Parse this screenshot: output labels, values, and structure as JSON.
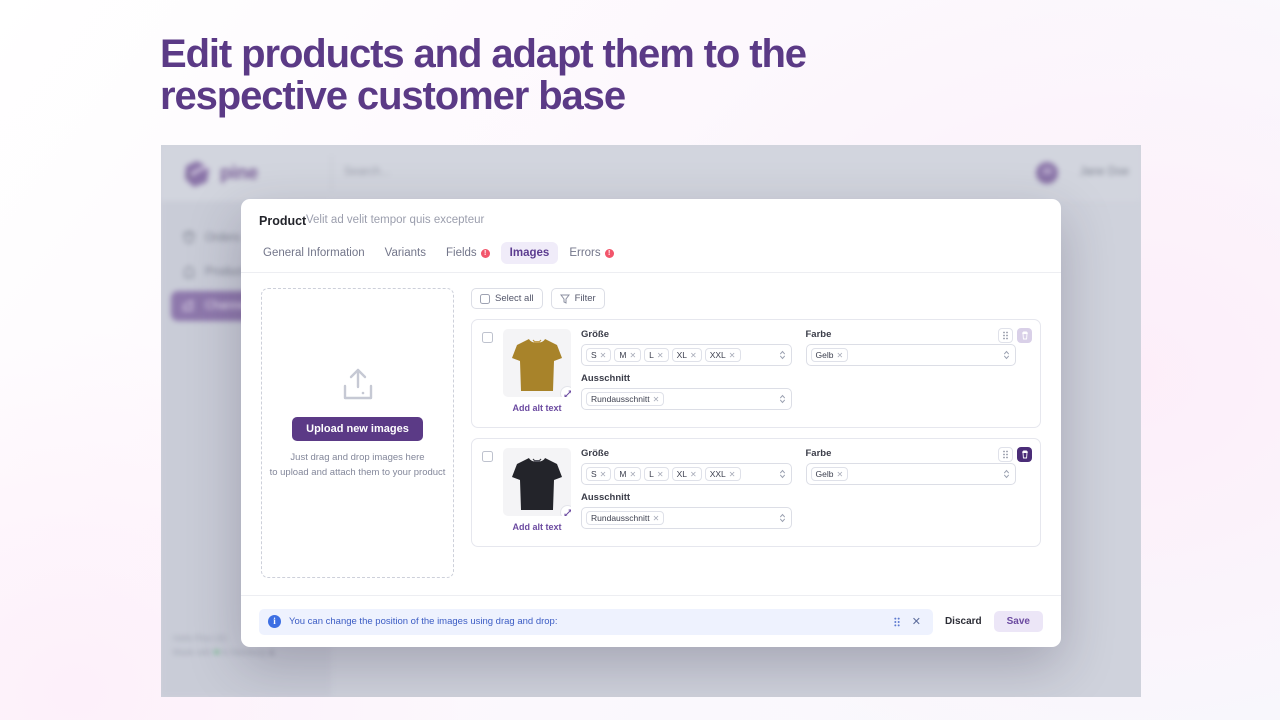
{
  "headline": {
    "line1": "Edit products and adapt them to the",
    "line2": "respective customer base"
  },
  "app": {
    "brand": "pine",
    "search_placeholder": "Search...",
    "user": {
      "name": "Jane Doe",
      "initials": "JD"
    },
    "nav": [
      {
        "label": "Orders",
        "icon": "bag-icon",
        "active": false
      },
      {
        "label": "Products",
        "icon": "tag-icon",
        "active": false
      },
      {
        "label": "Channels",
        "icon": "channel-icon",
        "active": true
      }
    ],
    "footer": {
      "company": "Hello Pine UG",
      "made_with_prefix": "Made with",
      "made_with_suffix": "in Hamburg"
    }
  },
  "modal": {
    "title": "Product",
    "subtitle": "Velit ad velit tempor quis excepteur",
    "tabs": [
      {
        "label": "General Information",
        "badge": false,
        "active": false
      },
      {
        "label": "Variants",
        "badge": false,
        "active": false
      },
      {
        "label": "Fields",
        "badge": true,
        "active": false
      },
      {
        "label": "Images",
        "badge": false,
        "active": true
      },
      {
        "label": "Errors",
        "badge": true,
        "active": false
      }
    ],
    "dropzone": {
      "button_label": "Upload new images",
      "hint_line1": "Just drag and drop images here",
      "hint_line2": "to upload and attach them to your product"
    },
    "toolbar": {
      "select_all_label": "Select all",
      "filter_label": "Filter"
    },
    "rows": [
      {
        "alt_link": "Add alt text",
        "shirt_color": "#a8832a",
        "delete_state": "soft",
        "fields": [
          {
            "label": "Größe",
            "chips": [
              "S",
              "M",
              "L",
              "XL",
              "XXL"
            ]
          },
          {
            "label": "Farbe",
            "chips": [
              "Gelb"
            ]
          },
          {
            "label": "Ausschnitt",
            "chips": [
              "Rundausschnitt"
            ]
          }
        ]
      },
      {
        "alt_link": "Add alt text",
        "shirt_color": "#23242a",
        "delete_state": "solid",
        "fields": [
          {
            "label": "Größe",
            "chips": [
              "S",
              "M",
              "L",
              "XL",
              "XXL"
            ]
          },
          {
            "label": "Farbe",
            "chips": [
              "Gelb"
            ]
          },
          {
            "label": "Ausschnitt",
            "chips": [
              "Rundausschnitt"
            ]
          }
        ]
      }
    ],
    "footer": {
      "info_text": "You can change the position of the images using drag and drop:",
      "discard_label": "Discard",
      "save_label": "Save"
    }
  },
  "colors": {
    "brand_purple": "#5b3a86",
    "accent_light": "#ece6f7",
    "warn_red": "#f2556b",
    "info_blue": "#3d6fe3"
  }
}
